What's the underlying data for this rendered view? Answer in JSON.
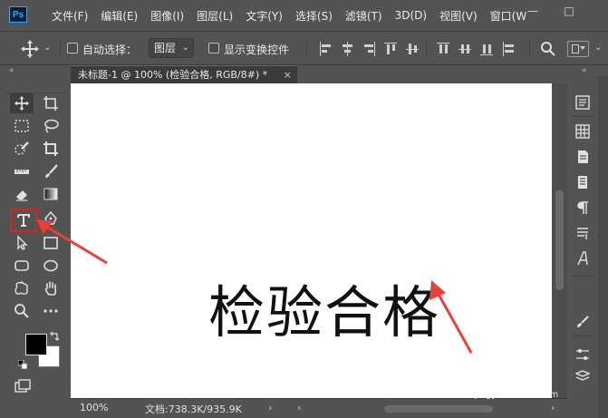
{
  "app": {
    "logo": "Ps"
  },
  "menu": [
    "文件(F)",
    "编辑(E)",
    "图像(I)",
    "图层(L)",
    "文字(Y)",
    "选择(S)",
    "滤镜(T)",
    "3D(D)",
    "视图(V)",
    "窗口(W"
  ],
  "window_controls": {
    "minimize": "—",
    "maximize": "□"
  },
  "options": {
    "auto_select_label": "自动选择：",
    "auto_select_value": "图层",
    "show_transform_label": "显示变换控件"
  },
  "document": {
    "tab_title": "未标题-1 @ 100% (检验合格, RGB/8#) *",
    "close": "×",
    "canvas_text": "检验合格"
  },
  "status": {
    "zoom": "100%",
    "doc_info": "文档:738.3K/935.9K",
    "more": "›",
    "scroll_left": "‹",
    "scroll_right": "›"
  },
  "collapse_glyph": "«",
  "watermark": {
    "title": "Bai经验",
    "subtitle": "jingyan.baidu.com"
  },
  "colors": {
    "annotation": "#e8413a",
    "foreground": "#000000",
    "background": "#ffffff",
    "ui": "#535353"
  }
}
